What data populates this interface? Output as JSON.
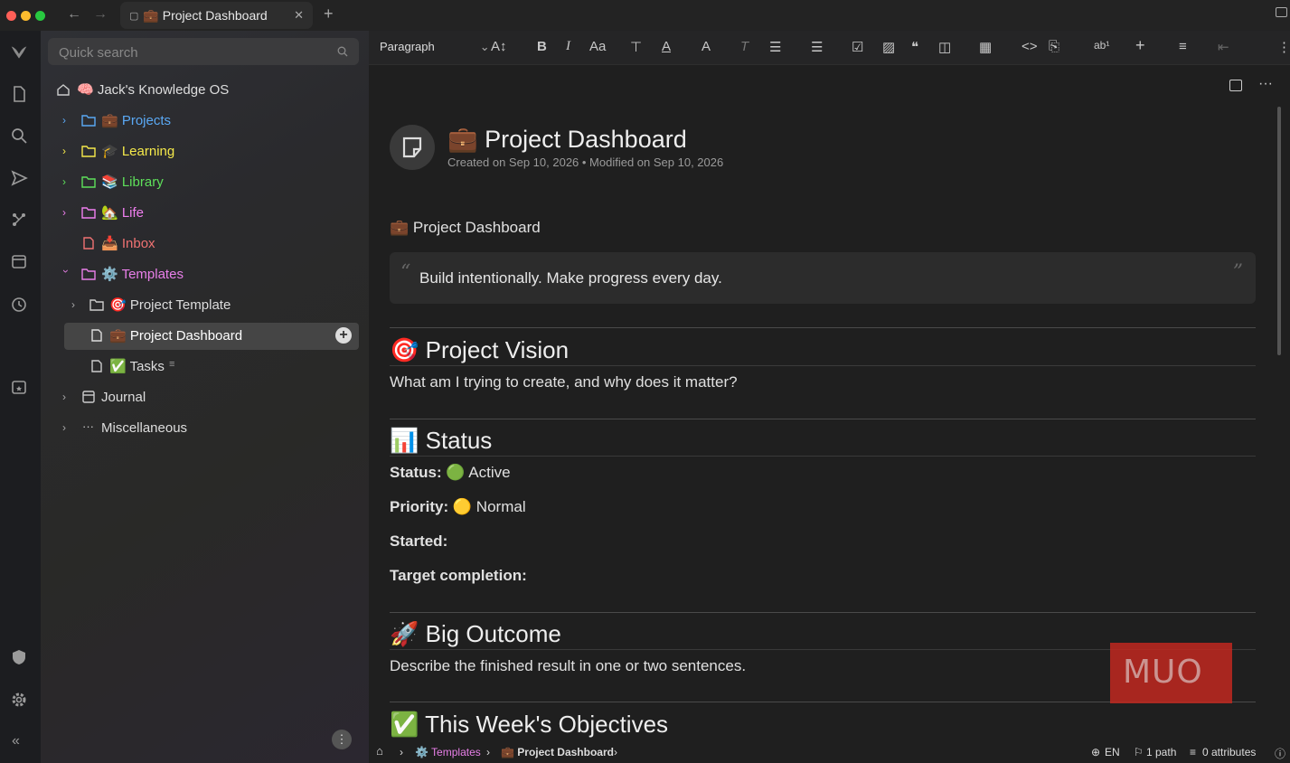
{
  "tab": {
    "title": "💼 Project Dashboard"
  },
  "sidebar": {
    "search_placeholder": "Quick search",
    "root": "🧠 Jack's Knowledge OS",
    "items": [
      {
        "label": "💼 Projects",
        "color": "#5aa9f5"
      },
      {
        "label": "🎓 Learning",
        "color": "#f5e94a"
      },
      {
        "label": "📚 Library",
        "color": "#5ee05a"
      },
      {
        "label": "🏡 Life",
        "color": "#f07ff0"
      },
      {
        "label": "📥 Inbox",
        "color": "#f07272"
      },
      {
        "label": "⚙️ Templates",
        "color": "#e87fe8"
      },
      {
        "label": "🎯 Project Template",
        "color": "#dddddd"
      },
      {
        "label": "💼 Project Dashboard",
        "color": "#ffffff"
      },
      {
        "label": "✅ Tasks",
        "color": "#dddddd"
      },
      {
        "label": "Journal",
        "color": "#dddddd"
      },
      {
        "label": "Miscellaneous",
        "color": "#dddddd"
      }
    ]
  },
  "toolbar": {
    "block_type": "Paragraph"
  },
  "note": {
    "title": "💼 Project Dashboard",
    "meta": "Created on Sep 10, 2026 • Modified on Sep 10, 2026",
    "first_line": "💼 Project Dashboard",
    "quote": "Build intentionally. Make progress every day.",
    "vision_heading": "🎯 Project Vision",
    "vision_text": "What am I trying to create, and why does it matter?",
    "status_heading": "📊 Status",
    "status_label": "Status:",
    "status_value": "🟢 Active",
    "priority_label": "Priority:",
    "priority_value": "🟡 Normal",
    "started_label": "Started:",
    "target_label": "Target completion:",
    "outcome_heading": "🚀 Big Outcome",
    "outcome_text": "Describe the finished result in one or two sentences.",
    "objectives_heading": "✅ This Week's Objectives"
  },
  "statusbar": {
    "crumb_1": "⚙️ Templates",
    "crumb_2": "💼 Project Dashboard",
    "lang": "EN",
    "paths": "1 path",
    "attributes": "0 attributes"
  },
  "watermark": "MUO",
  "colors": {
    "accent_blue": "#5aa9f5",
    "traffic_red": "#ff5f57",
    "traffic_yellow": "#febc2e",
    "traffic_green": "#28c840"
  }
}
